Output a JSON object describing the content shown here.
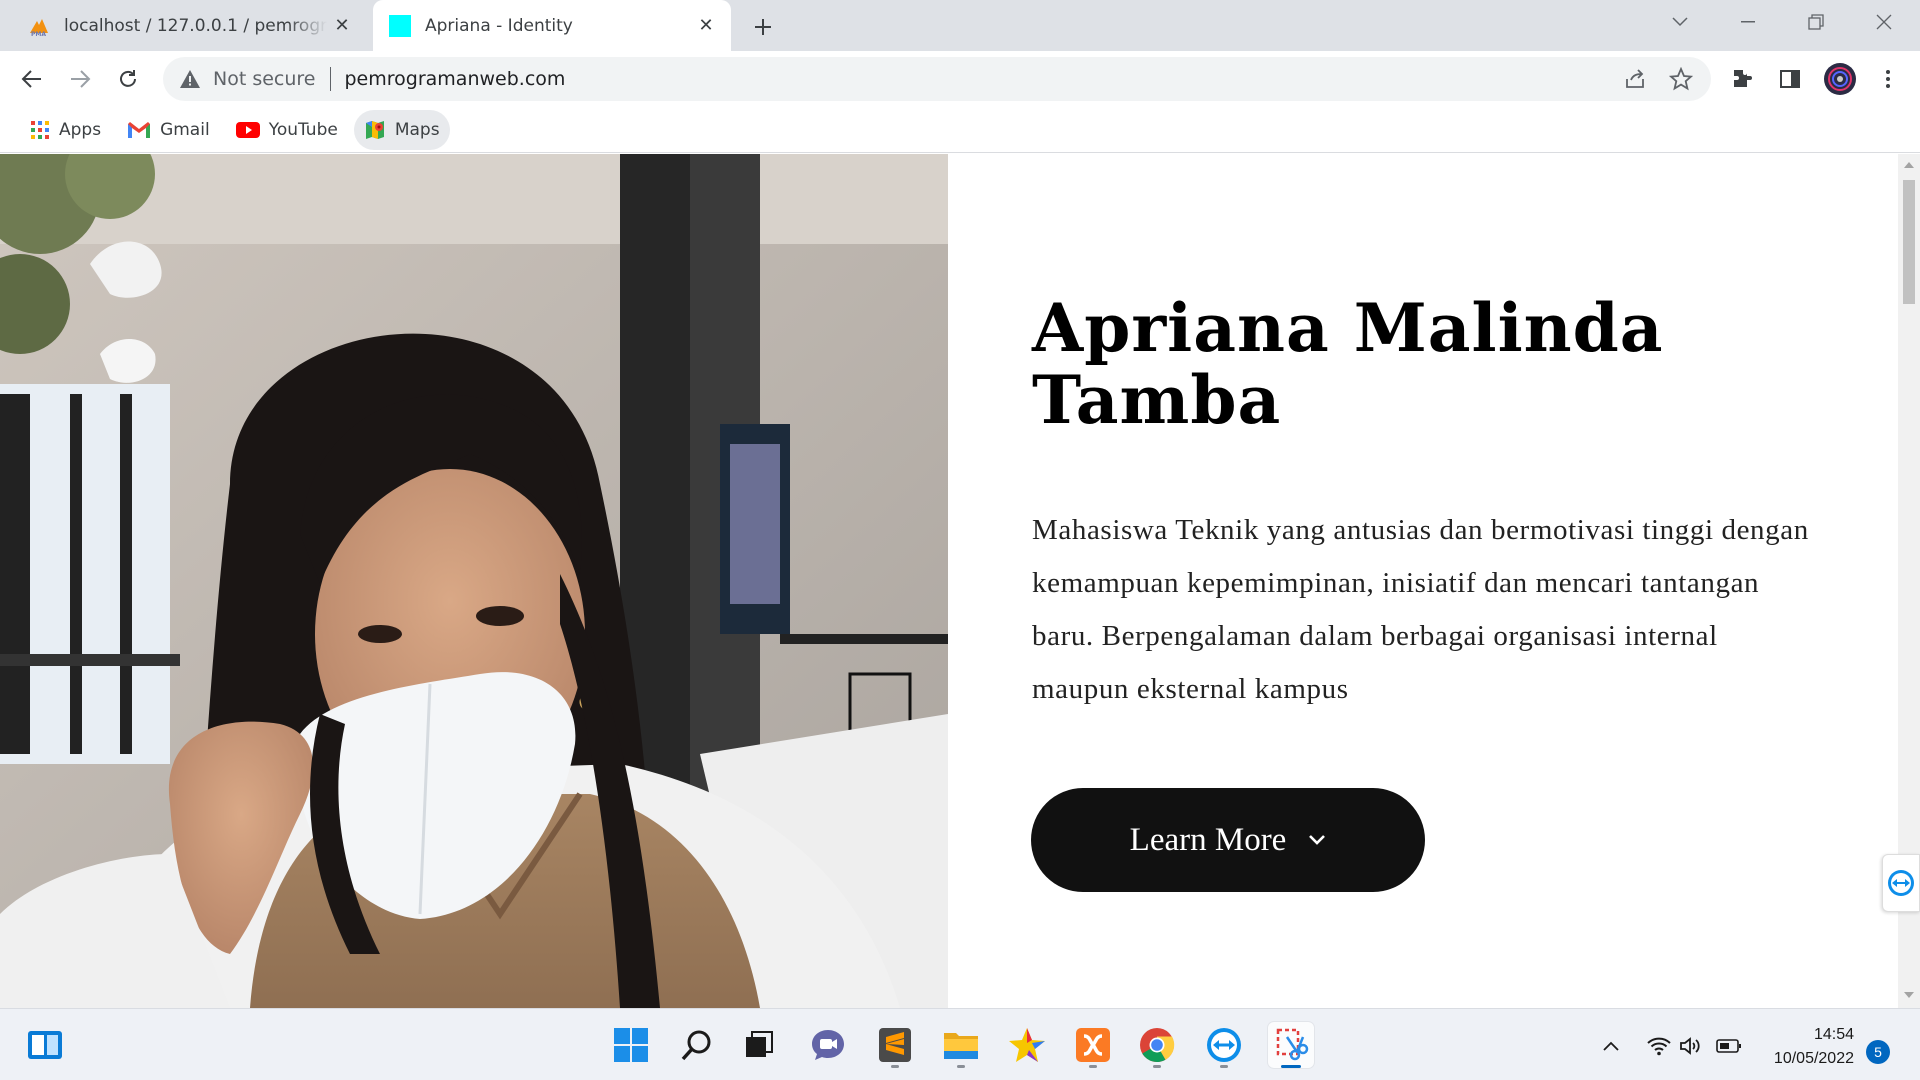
{
  "browser": {
    "tabs": [
      {
        "title": "localhost / 127.0.0.1 / pemrograman",
        "favicon": "phpmyadmin-icon",
        "active": false
      },
      {
        "title": "Apriana - Identity",
        "favicon": "cyan-square-icon",
        "active": true
      }
    ],
    "omnibox": {
      "security_label": "Not secure",
      "url": "pemrogramanweb.com"
    },
    "bookmarks": [
      {
        "label": "Apps",
        "icon": "apps-grid-icon"
      },
      {
        "label": "Gmail",
        "icon": "gmail-icon"
      },
      {
        "label": "YouTube",
        "icon": "youtube-icon"
      },
      {
        "label": "Maps",
        "icon": "maps-icon"
      }
    ]
  },
  "hero": {
    "name": "Apriana Malinda Tamba",
    "description": "Mahasiswa Teknik yang antusias dan bermotivasi tinggi dengan kemampuan kepemimpinan, inisiatif dan mencari tantangan baru. Berpengalaman dalam berbagai organisasi internal maupun eksternal kampus",
    "button_label": "Learn More"
  },
  "taskbar": {
    "apps": [
      "start-icon",
      "search-icon",
      "task-view-icon",
      "chat-icon",
      "sublime-text-icon",
      "file-explorer-icon",
      "star-app-icon",
      "xampp-icon",
      "chrome-icon",
      "teamviewer-icon",
      "snipping-tool-icon"
    ],
    "time": "14:54",
    "date": "10/05/2022",
    "notification_count": "5"
  },
  "colors": {
    "tabstrip": "#dee1e6",
    "button_bg": "#111111",
    "taskbar": "#eef1f6",
    "accent": "#0067c0"
  }
}
